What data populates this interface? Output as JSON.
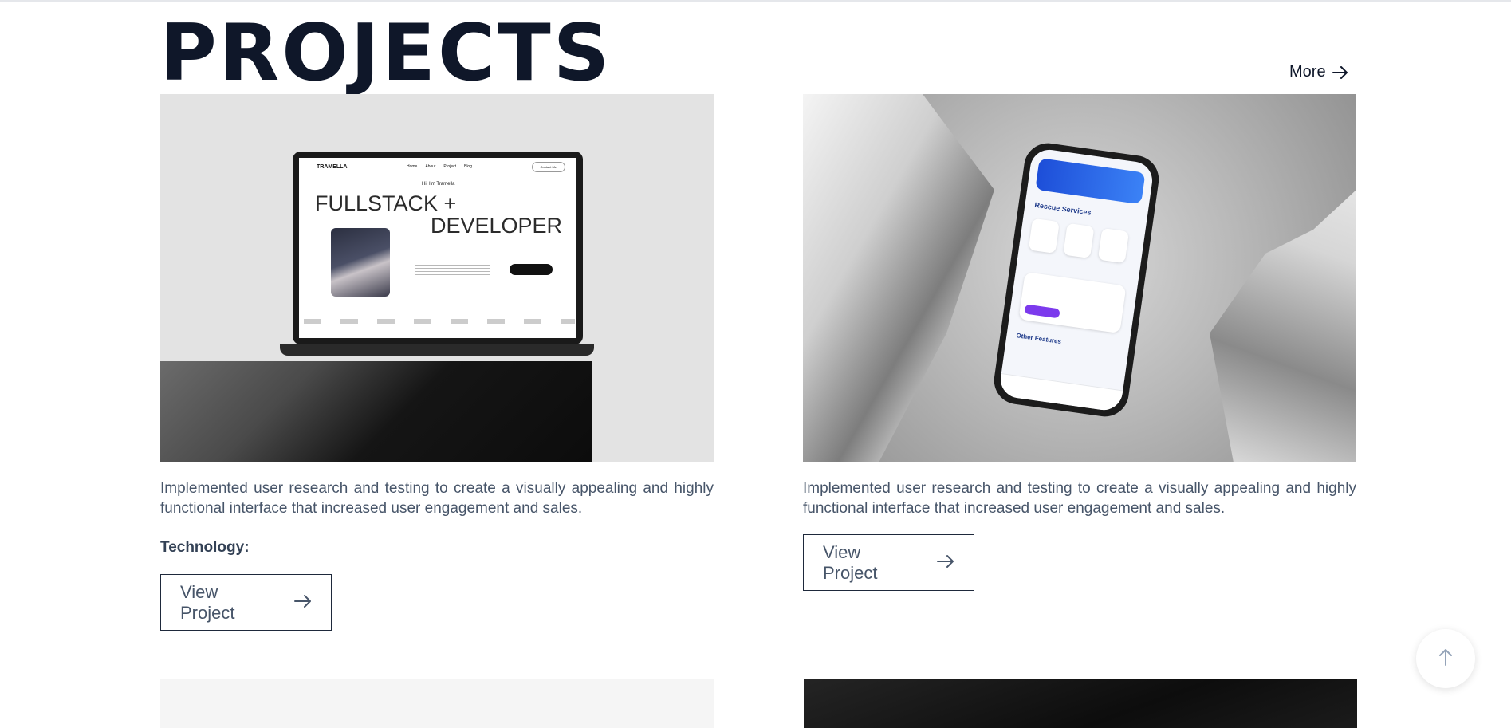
{
  "section": {
    "title": "PROJECTS",
    "more_label": "More"
  },
  "projects": [
    {
      "description": "Implemented user research and testing to create a visually appealing and highly functional interface that increased user engagement and sales.",
      "technology_label": "Technology:",
      "view_label": "View Project",
      "mockup": {
        "logo": "TRAMELLA",
        "nav": [
          "Home",
          "About",
          "Project",
          "Blog"
        ],
        "contact": "Contact Me",
        "greeting": "Hi! I'm Tramella",
        "headline_1": "FULLSTACK +",
        "headline_2": "DEVELOPER"
      }
    },
    {
      "description": "Implemented user research and testing to create a visually appealing and highly functional interface that increased user engagement and sales.",
      "view_label": "View Project",
      "mockup": {
        "services_title": "Rescue Services",
        "other_title": "Other Features"
      }
    }
  ],
  "icons": {
    "more_arrow": "arrow-right-icon",
    "view_arrow": "arrow-right-icon",
    "back_to_top": "arrow-up-icon"
  }
}
